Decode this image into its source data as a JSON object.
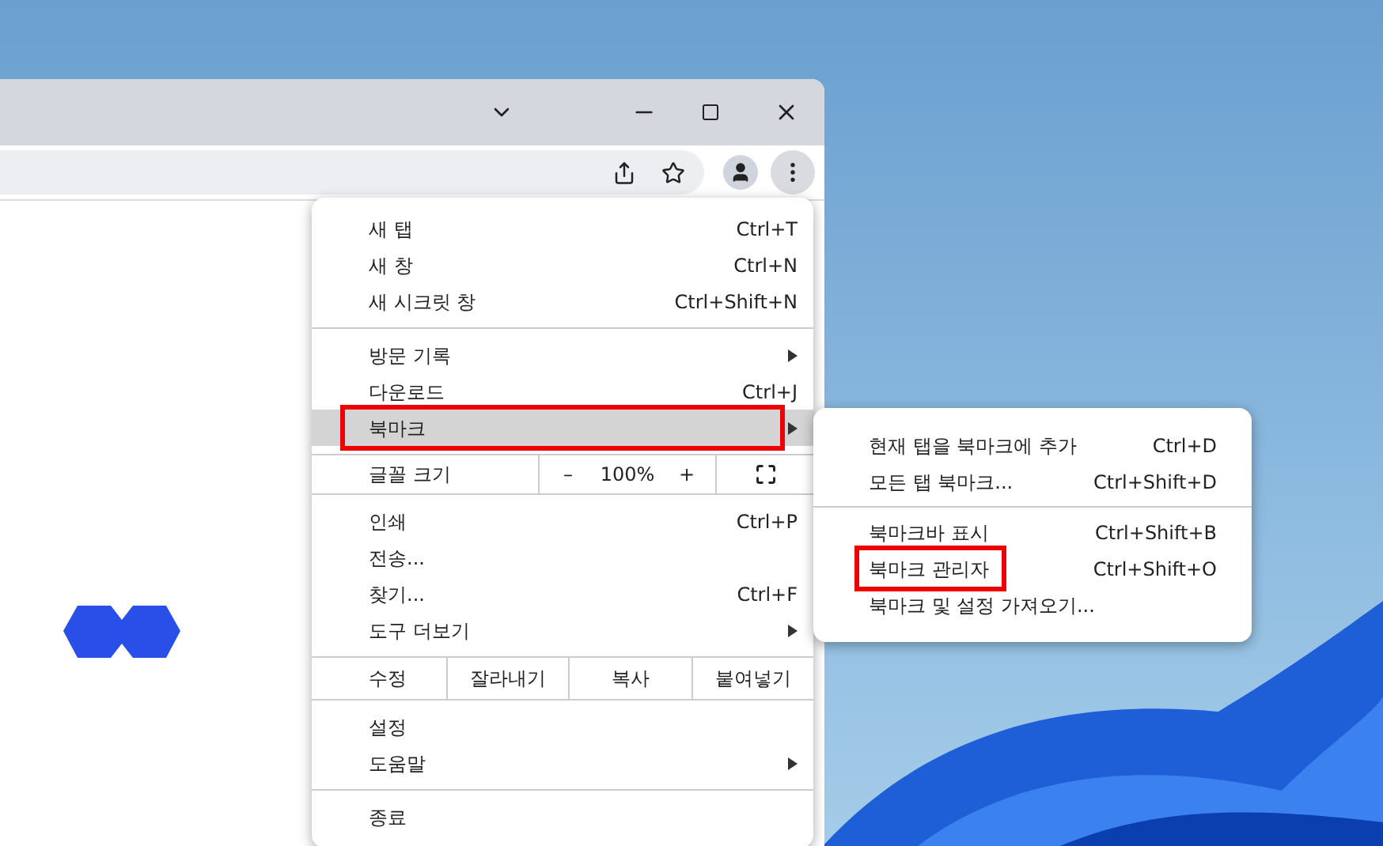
{
  "menu": {
    "sections": [
      {
        "items": [
          {
            "kind": "item",
            "label": "새 탭",
            "shortcut": "Ctrl+T",
            "submenu": false,
            "highlighted": false,
            "selected": false
          },
          {
            "kind": "item",
            "label": "새 창",
            "shortcut": "Ctrl+N",
            "submenu": false,
            "highlighted": false,
            "selected": false
          },
          {
            "kind": "item",
            "label": "새 시크릿 창",
            "shortcut": "Ctrl+Shift+N",
            "submenu": false,
            "highlighted": false,
            "selected": false
          }
        ]
      },
      {
        "items": [
          {
            "kind": "item",
            "label": "방문 기록",
            "submenu": true,
            "highlighted": false,
            "selected": false
          },
          {
            "kind": "item",
            "label": "다운로드",
            "shortcut": "Ctrl+J",
            "submenu": false,
            "highlighted": false,
            "selected": false
          },
          {
            "kind": "item",
            "label": "북마크",
            "submenu": true,
            "highlighted": true,
            "selected": true
          }
        ]
      },
      {
        "items": [
          {
            "kind": "zoom",
            "label": "글꼴 크기",
            "minus": "–",
            "value": "100%",
            "plus": "+"
          }
        ]
      },
      {
        "items": [
          {
            "kind": "item",
            "label": "인쇄",
            "shortcut": "Ctrl+P",
            "submenu": false,
            "highlighted": false,
            "selected": false
          },
          {
            "kind": "item",
            "label": "전송...",
            "submenu": false,
            "highlighted": false,
            "selected": false
          },
          {
            "kind": "item",
            "label": "찾기...",
            "shortcut": "Ctrl+F",
            "submenu": false,
            "highlighted": false,
            "selected": false
          },
          {
            "kind": "item",
            "label": "도구 더보기",
            "submenu": true,
            "highlighted": false,
            "selected": false
          }
        ]
      },
      {
        "items": [
          {
            "kind": "edit",
            "label": "수정",
            "buttons": [
              "잘라내기",
              "복사",
              "붙여넣기"
            ]
          }
        ]
      },
      {
        "items": [
          {
            "kind": "item",
            "label": "설정",
            "submenu": false,
            "highlighted": false,
            "selected": false
          },
          {
            "kind": "item",
            "label": "도움말",
            "submenu": true,
            "highlighted": false,
            "selected": false
          }
        ]
      },
      {
        "items": [
          {
            "kind": "item",
            "label": "종료",
            "submenu": false,
            "highlighted": false,
            "selected": false
          }
        ]
      }
    ]
  },
  "submenu": {
    "sections": [
      {
        "items": [
          {
            "label": "현재 탭을 북마크에 추가",
            "shortcut": "Ctrl+D",
            "highlighted": false
          },
          {
            "label": "모든 탭 북마크...",
            "shortcut": "Ctrl+Shift+D",
            "highlighted": false
          }
        ]
      },
      {
        "items": [
          {
            "label": "북마크바 표시",
            "shortcut": "Ctrl+Shift+B",
            "highlighted": false
          },
          {
            "label": "북마크 관리자",
            "shortcut": "Ctrl+Shift+O",
            "highlighted": true
          },
          {
            "label": "북마크 및 설정 가져오기...",
            "highlighted": false
          }
        ]
      }
    ]
  }
}
